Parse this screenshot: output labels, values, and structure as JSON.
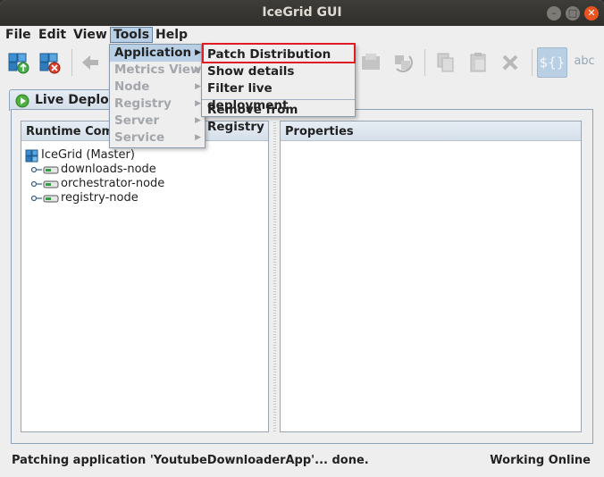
{
  "window": {
    "title": "IceGrid GUI"
  },
  "menubar": {
    "items": [
      {
        "label": "File"
      },
      {
        "label": "Edit"
      },
      {
        "label": "View"
      },
      {
        "label": "Tools"
      },
      {
        "label": "Help"
      }
    ]
  },
  "toolbar": {
    "text_buttons": {
      "dollar": "${}",
      "abc": "abc"
    }
  },
  "tab": {
    "label": "Live Deploy"
  },
  "runtime_pane": {
    "header": "Runtime Com"
  },
  "properties_pane": {
    "header": "Properties"
  },
  "tree": {
    "root": "IceGrid (Master)",
    "nodes": [
      "downloads-node",
      "orchestrator-node",
      "registry-node"
    ]
  },
  "tools_menu": {
    "items": [
      {
        "label": "Application",
        "enabled": true,
        "submenu": true
      },
      {
        "label": "Metrics View",
        "enabled": false,
        "submenu": true
      },
      {
        "label": "Node",
        "enabled": false,
        "submenu": true
      },
      {
        "label": "Registry",
        "enabled": false,
        "submenu": true
      },
      {
        "label": "Server",
        "enabled": false,
        "submenu": true
      },
      {
        "label": "Service",
        "enabled": false,
        "submenu": true
      }
    ]
  },
  "application_submenu": {
    "items": [
      {
        "label": "Patch Distribution"
      },
      {
        "label": "Show details"
      },
      {
        "label": "Filter live deployment"
      },
      {
        "label": "Remove from Registry"
      }
    ]
  },
  "statusbar": {
    "message": "Patching application 'YoutubeDownloaderApp'... done.",
    "state": "Working Online"
  },
  "colors": {
    "selection": "#b8cfe5",
    "highlight_box": "#e01b24",
    "titlebar": "#3c3b37",
    "close_button": "#e9541f"
  }
}
